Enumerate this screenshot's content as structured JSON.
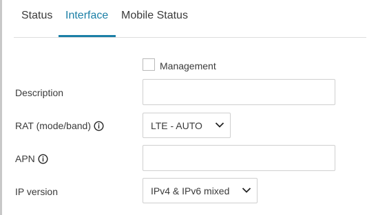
{
  "tabs": [
    {
      "label": "Status",
      "active": false
    },
    {
      "label": "Interface",
      "active": true
    },
    {
      "label": "Mobile Status",
      "active": false
    }
  ],
  "form": {
    "management": {
      "label": "Management",
      "checked": false
    },
    "description": {
      "label": "Description",
      "value": ""
    },
    "rat": {
      "label": "RAT (mode/band)",
      "value": "LTE - AUTO"
    },
    "apn": {
      "label": "APN",
      "value": ""
    },
    "ip_version": {
      "label": "IP version",
      "value": "IPv4 & IPv6 mixed"
    }
  },
  "colors": {
    "accent": "#1a7fa6",
    "text": "#3a3a3a",
    "border": "#cfcfcf"
  },
  "icons": {
    "info": "info-circle-icon",
    "dropdown": "chevron-down-icon"
  }
}
